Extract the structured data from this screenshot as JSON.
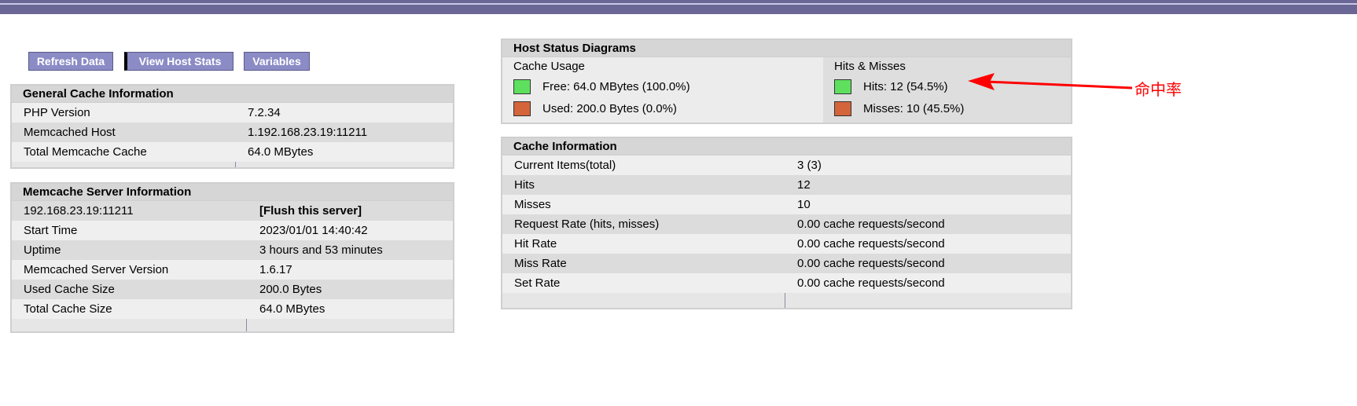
{
  "menu": {
    "refresh": "Refresh Data",
    "view_host_stats": "View Host Stats",
    "variables": "Variables"
  },
  "general": {
    "title": "General Cache Information",
    "rows": [
      {
        "k": "PHP Version",
        "v": "7.2.34"
      },
      {
        "k": "Memcached Host",
        "v": "1.192.168.23.19:11211"
      },
      {
        "k": "Total Memcache Cache",
        "v": "64.0 MBytes"
      }
    ]
  },
  "server": {
    "title": "Memcache Server Information",
    "host": "192.168.23.19:11211",
    "flush_label": "[Flush this server]",
    "rows": [
      {
        "k": "Start Time",
        "v": "2023/01/01 14:40:42"
      },
      {
        "k": "Uptime",
        "v": "3 hours and 53 minutes"
      },
      {
        "k": "Memcached Server Version",
        "v": "1.6.17"
      },
      {
        "k": "Used Cache Size",
        "v": "200.0 Bytes"
      },
      {
        "k": "Total Cache Size",
        "v": "64.0 MBytes"
      }
    ]
  },
  "host_status": {
    "title": "Host Status Diagrams",
    "cache_usage": {
      "header": "Cache Usage",
      "free": "Free: 64.0 MBytes (100.0%)",
      "used": "Used: 200.0 Bytes (0.0%)"
    },
    "hits_misses": {
      "header": "Hits & Misses",
      "hits": "Hits: 12 (54.5%)",
      "misses": "Misses: 10 (45.5%)"
    }
  },
  "cache_info": {
    "title": "Cache Information",
    "rows": [
      {
        "k": "Current Items(total)",
        "v": "3 (3)"
      },
      {
        "k": "Hits",
        "v": "12"
      },
      {
        "k": "Misses",
        "v": "10"
      },
      {
        "k": "Request Rate (hits, misses)",
        "v": "0.00 cache requests/second"
      },
      {
        "k": "Hit Rate",
        "v": "0.00 cache requests/second"
      },
      {
        "k": "Miss Rate",
        "v": "0.00 cache requests/second"
      },
      {
        "k": "Set Rate",
        "v": "0.00 cache requests/second"
      }
    ]
  },
  "annotation": {
    "text": "命中率"
  },
  "colors": {
    "free_green": "#5ee05e",
    "used_orange": "#d4643a",
    "header_bar": "#6a6796",
    "button_bg": "#8b8bc6",
    "annotation_red": "#ff0000"
  }
}
